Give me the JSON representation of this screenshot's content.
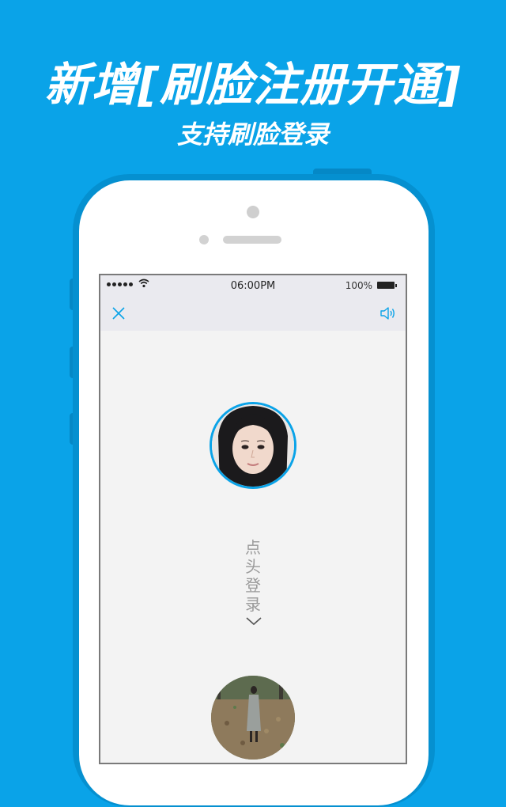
{
  "promo": {
    "headline": "新增[刷脸注册开通]",
    "subheadline": "支持刷脸登录"
  },
  "status_bar": {
    "time": "06:00PM",
    "battery": "100%"
  },
  "nav": {
    "close_icon": "close-icon",
    "sound_icon": "speaker-icon"
  },
  "main": {
    "instruction_chars": [
      "点",
      "头",
      "登",
      "录"
    ],
    "chevron_icon": "chevron-down-icon"
  },
  "colors": {
    "accent": "#0aa3e8",
    "background": "#0aa3e8",
    "screen_bg": "#f3f3f3"
  }
}
